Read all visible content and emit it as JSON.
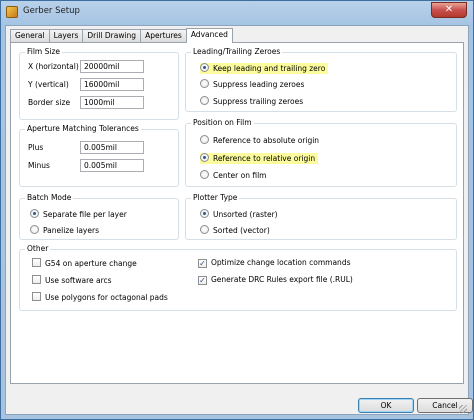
{
  "window": {
    "title": "Gerber Setup",
    "close_glyph": "✕",
    "ok": "OK",
    "cancel": "Cancel"
  },
  "tabs": [
    "General",
    "Layers",
    "Drill Drawing",
    "Apertures",
    "Advanced"
  ],
  "active_tab": "Advanced",
  "film_size": {
    "legend": "Film Size",
    "x_label": "X (horizontal)",
    "x_value": "20000mil",
    "y_label": "Y (vertical)",
    "y_value": "16000mil",
    "border_label": "Border size",
    "border_value": "1000mil"
  },
  "aperture_tol": {
    "legend": "Aperture Matching Tolerances",
    "plus_label": "Plus",
    "plus_value": "0.005mil",
    "minus_label": "Minus",
    "minus_value": "0.005mil"
  },
  "zeroes": {
    "legend": "Leading/Trailing Zeroes",
    "options": [
      "Keep leading and trailing zero",
      "Suppress leading zeroes",
      "Suppress trailing zeroes"
    ],
    "selected": 0
  },
  "position": {
    "legend": "Position on Film",
    "options": [
      "Reference to absolute origin",
      "Reference to relative origin",
      "Center on film"
    ],
    "selected": 1
  },
  "batch": {
    "legend": "Batch Mode",
    "options": [
      "Separate file per layer",
      "Panelize layers"
    ],
    "selected": 0
  },
  "plotter": {
    "legend": "Plotter Type",
    "options": [
      "Unsorted (raster)",
      "Sorted (vector)"
    ],
    "selected": 0
  },
  "other": {
    "legend": "Other",
    "left": [
      {
        "label": "G54 on aperture change",
        "checked": false
      },
      {
        "label": "Use software arcs",
        "checked": false
      },
      {
        "label": "Use polygons for octagonal pads",
        "checked": false
      }
    ],
    "right": [
      {
        "label": "Optimize change location commands",
        "checked": true
      },
      {
        "label": "Generate DRC Rules export file (.RUL)",
        "checked": true
      }
    ]
  },
  "colors": {
    "highlight": "#fcfc9e",
    "window_frame": "#a5c4e4",
    "close_button": "#c75050"
  },
  "icons": {
    "app": "gerber-app-icon",
    "close": "close-icon"
  }
}
